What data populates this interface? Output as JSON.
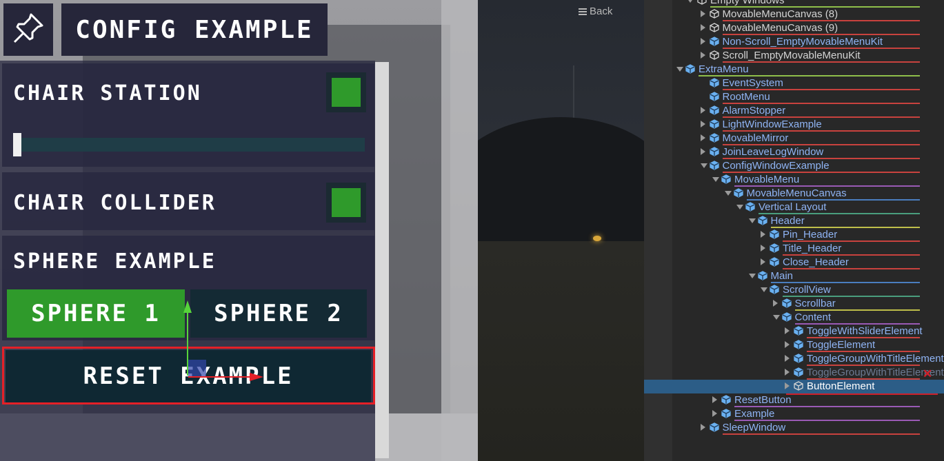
{
  "menu": {
    "title": "CONFIG EXAMPLE",
    "rows": {
      "chair_station": "CHAIR STATION",
      "chair_collider": "CHAIR COLLIDER",
      "sphere_example": "SPHERE EXAMPLE"
    },
    "sphere_buttons": [
      "SPHERE 1",
      "SPHERE 2"
    ],
    "reset_label": "RESET EXAMPLE",
    "toggles": {
      "chair_station": true,
      "chair_collider": true
    },
    "slider_value": 0.0,
    "selected_sphere": "SPHERE 1",
    "colors": {
      "toggle_on": "#2f9a2b",
      "close": "#e02a2f",
      "highlight": "#e52027"
    }
  },
  "camera_view": {
    "back_label": "Back"
  },
  "hierarchy": {
    "partial_top_label": "Empty Windows",
    "items": [
      {
        "label": "MovableMenuCanvas (8)",
        "style": "plain"
      },
      {
        "label": "MovableMenuCanvas (9)",
        "style": "plain"
      },
      {
        "label": "Non-Scroll_EmptyMovableMenuKit",
        "style": "prefab"
      },
      {
        "label": "Scroll_EmptyMovableMenuKit",
        "style": "plain"
      },
      {
        "label": "ExtraMenu",
        "style": "prefab"
      },
      {
        "label": "EventSystem",
        "style": "prefab"
      },
      {
        "label": "RootMenu",
        "style": "prefab"
      },
      {
        "label": "AlarmStopper",
        "style": "prefab"
      },
      {
        "label": "LightWindowExample",
        "style": "prefab"
      },
      {
        "label": "MovableMirror",
        "style": "prefab"
      },
      {
        "label": "JoinLeaveLogWindow",
        "style": "prefab"
      },
      {
        "label": "ConfigWindowExample",
        "style": "prefab"
      },
      {
        "label": "MovableMenu",
        "style": "prefab"
      },
      {
        "label": "MovableMenuCanvas",
        "style": "prefab"
      },
      {
        "label": "Vertical Layout",
        "style": "prefab"
      },
      {
        "label": "Header",
        "style": "prefab"
      },
      {
        "label": "Pin_Header",
        "style": "prefab"
      },
      {
        "label": "Title_Header",
        "style": "prefab"
      },
      {
        "label": "Close_Header",
        "style": "prefab"
      },
      {
        "label": "Main",
        "style": "prefab"
      },
      {
        "label": "ScrollView",
        "style": "prefab"
      },
      {
        "label": "Scrollbar",
        "style": "prefab"
      },
      {
        "label": "Content",
        "style": "prefab"
      },
      {
        "label": "ToggleWithSliderElement",
        "style": "prefab"
      },
      {
        "label": "ToggleElement",
        "style": "prefab"
      },
      {
        "label": "ToggleGroupWithTitleElement",
        "style": "prefab"
      },
      {
        "label": "ToggleGroupWithTitleElement",
        "style": "dim"
      },
      {
        "label": "ButtonElement",
        "style": "selected"
      },
      {
        "label": "ResetButton",
        "style": "prefab"
      },
      {
        "label": "Example",
        "style": "prefab"
      },
      {
        "label": "SleepWindow",
        "style": "prefab"
      }
    ]
  }
}
